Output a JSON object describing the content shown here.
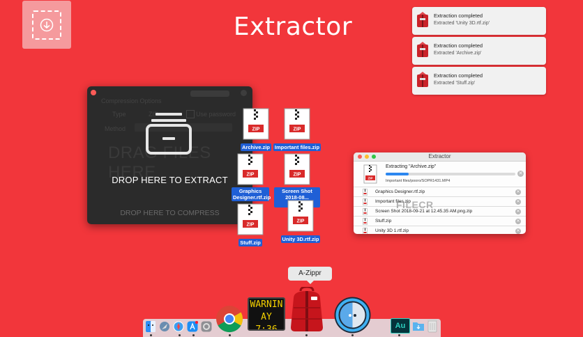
{
  "app_title": "Extractor",
  "notifications": [
    {
      "title": "Extraction completed",
      "subtitle": "Extracted 'Unity 3D.rtf.zip'"
    },
    {
      "title": "Extraction completed",
      "subtitle": "Extracted 'Archive.zip'"
    },
    {
      "title": "Extraction completed",
      "subtitle": "Extracted 'Stuff.zip'"
    }
  ],
  "drop_window": {
    "bg_options_title": "Compression Options",
    "bg_type_label": "Type",
    "bg_type_value": "ZIP",
    "bg_password_label": "Use password",
    "bg_method_label": "Method",
    "bg_big_text": "DRAG FILES HERE",
    "extract_label": "DROP HERE TO EXTRACT",
    "compress_label": "DROP HERE TO COMPRESS"
  },
  "files": [
    {
      "label": "Archive.zip"
    },
    {
      "label": "Important files.zip"
    },
    {
      "label": "Graphics Designer.rtf.zip"
    },
    {
      "label": "Screen Shot 2018-08... png.zip"
    },
    {
      "label": "Stuff.zip"
    },
    {
      "label": "Unity 3D.rtf.zip"
    }
  ],
  "extractor_window": {
    "title": "Extractor",
    "progress_title": "Extracting \"Archive.zip\"",
    "progress_subtitle": "Important files/pooro/SOPR1431.MP4",
    "progress_fraction": 0.18,
    "queue": [
      "Graphics Designer.rtf.zip",
      "Important files.zip",
      "Screen Shot 2018-09-21 at 12.45.35 AM.png.zip",
      "Stuff.zip",
      "Unity 3D 1.rtf.zip"
    ]
  },
  "watermark": "FILECR",
  "dock": {
    "tooltip": "A-Zippr",
    "clock_line1": "WARNIN",
    "clock_line2": "AY 7:36",
    "au_label": "Au"
  },
  "colors": {
    "background": "#f2363b",
    "zip_red": "#d92a2a",
    "progress_blue": "#2c87f0",
    "selection_blue": "#1f5fd6"
  }
}
